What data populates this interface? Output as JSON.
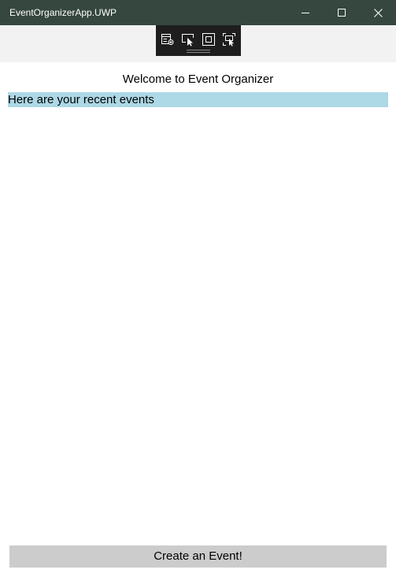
{
  "window": {
    "title": "EventOrganizerApp.UWP",
    "titlebar_color": "#35473f"
  },
  "caption_buttons": {
    "minimize_icon": "minimize-icon",
    "maximize_icon": "maximize-icon",
    "close_icon": "close-icon"
  },
  "dev_toolbar": {
    "tools": [
      "live-visual-tree-icon",
      "select-element-icon",
      "display-layout-adorners-icon",
      "track-focused-element-icon"
    ]
  },
  "main": {
    "welcome_text": "Welcome to Event Organizer",
    "recent_label": "Here are your recent events",
    "recent_highlight_color": "#add8e6",
    "create_button_label": "Create an Event!"
  }
}
